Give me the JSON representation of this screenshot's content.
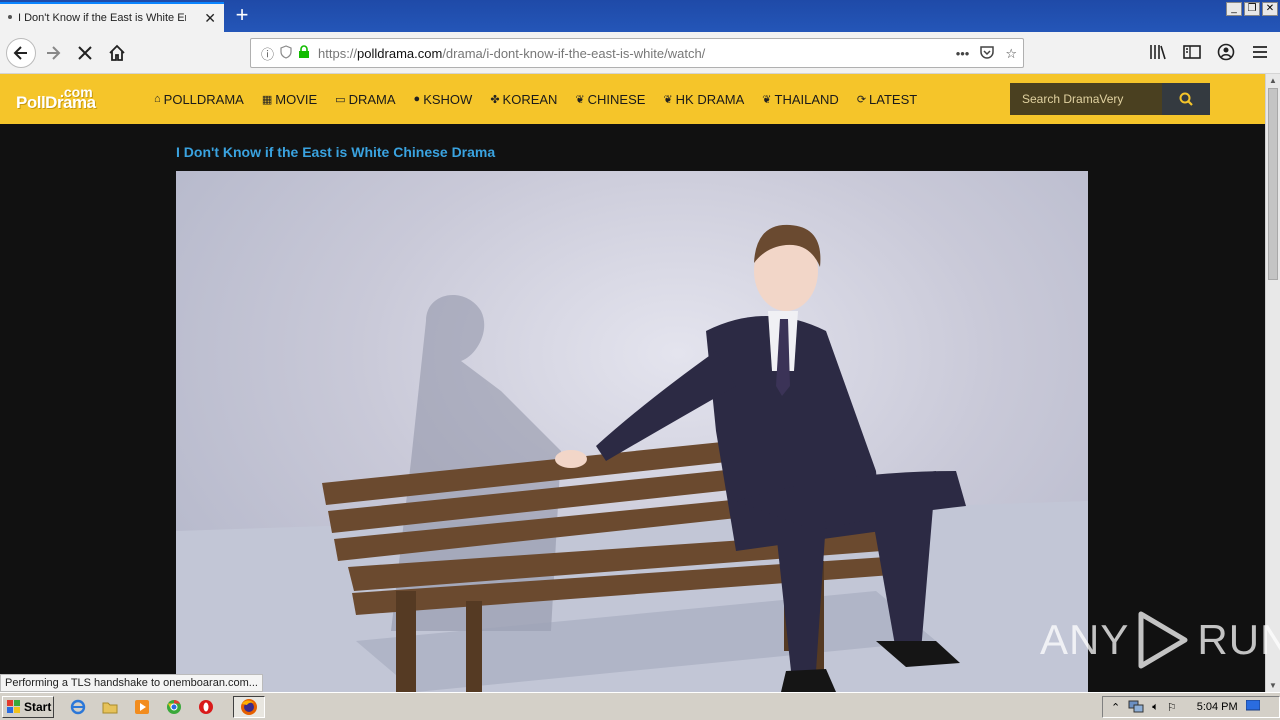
{
  "browser": {
    "tab_title": "I Don't Know if the East is White Er",
    "url_host_prefix": "https://",
    "url_host": "polldrama.com",
    "url_path": "/drama/i-dont-know-if-the-east-is-white/watch/",
    "status_text": "Performing a TLS handshake to onemboaran.com..."
  },
  "site": {
    "logo_main": "PollDrama",
    "logo_suffix": ".com",
    "menu": [
      {
        "label": "POLLDRAMA",
        "icon": "home-icon"
      },
      {
        "label": "MOVIE",
        "icon": "film-icon"
      },
      {
        "label": "DRAMA",
        "icon": "tv-icon"
      },
      {
        "label": "KSHOW",
        "icon": "globe-icon"
      },
      {
        "label": "KOREAN",
        "icon": "yin-icon"
      },
      {
        "label": "CHINESE",
        "icon": "leaf-icon"
      },
      {
        "label": "HK DRAMA",
        "icon": "leaf-icon"
      },
      {
        "label": "THAILAND",
        "icon": "leaf-icon"
      },
      {
        "label": "LATEST",
        "icon": "refresh-icon"
      }
    ],
    "search_placeholder": "Search DramaVery",
    "accent": "#f5c52a",
    "heading_color": "#3aa3e0"
  },
  "content": {
    "heading": "I Don't Know if the East is White Chinese Drama"
  },
  "watermark": {
    "left": "ANY",
    "right": "RUN"
  },
  "taskbar": {
    "start_label": "Start",
    "clock": "5:04 PM"
  }
}
